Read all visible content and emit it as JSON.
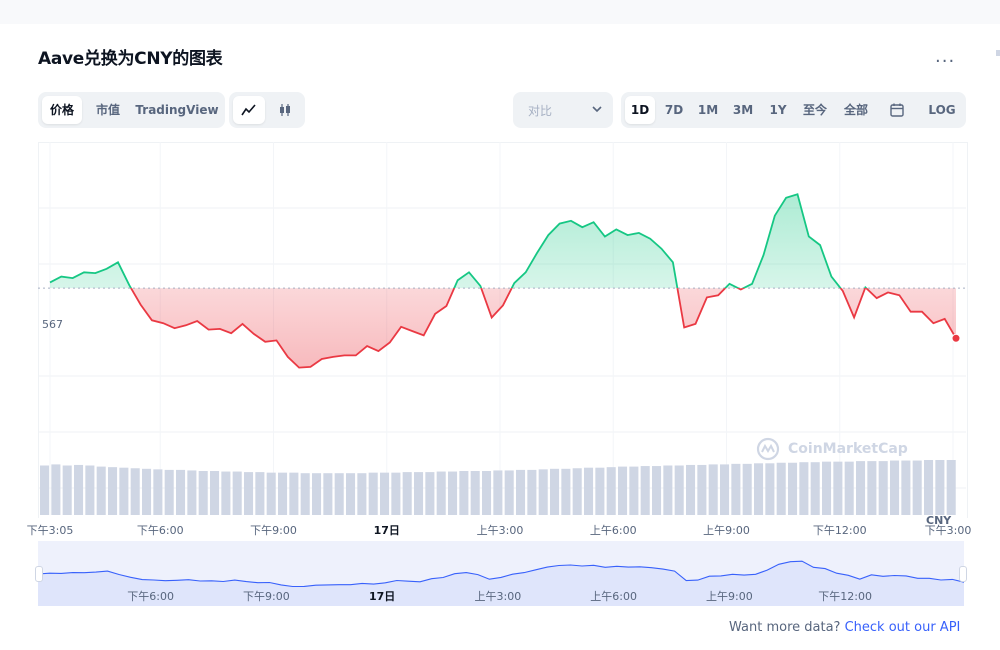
{
  "title": "Aave兑换为CNY的图表",
  "more_label": "...",
  "type_tabs": [
    "价格",
    "市值",
    "TradingView"
  ],
  "active_type": "价格",
  "chart_style_icons": [
    "line-chart-icon",
    "candlestick-icon"
  ],
  "compare": {
    "label": "对比"
  },
  "ranges": [
    "1D",
    "7D",
    "1M",
    "3M",
    "1Y",
    "至今",
    "全部",
    "LOG"
  ],
  "active_range": "1D",
  "currency": "CNY",
  "watermark": "CoinMarketCap",
  "footer": {
    "text": "Want more data?",
    "link": "Check out our API"
  },
  "colors": {
    "up": "#16c784",
    "down": "#ea3943",
    "accent": "#3861fb",
    "volume": "#cfd6e4"
  },
  "chart_data": {
    "type": "line",
    "baseline": 567,
    "ylabel_visible": "567",
    "x_ticks": [
      "下午3:05",
      "下午6:00",
      "下午9:00",
      "17日",
      "上午3:00",
      "上午6:00",
      "上午9:00",
      "下午12:00",
      "下午3:00"
    ],
    "x_tick_hours": [
      0,
      2.92,
      5.92,
      8.92,
      11.92,
      14.92,
      17.92,
      20.92,
      23.92
    ],
    "ylim": [
      543,
      586
    ],
    "x_hours": [
      0,
      0.3,
      0.6,
      0.9,
      1.2,
      1.5,
      1.8,
      2.1,
      2.4,
      2.7,
      3.0,
      3.3,
      3.6,
      3.9,
      4.2,
      4.5,
      4.8,
      5.1,
      5.4,
      5.7,
      6.0,
      6.3,
      6.6,
      6.9,
      7.2,
      7.5,
      7.8,
      8.1,
      8.4,
      8.7,
      9.0,
      9.3,
      9.6,
      9.9,
      10.2,
      10.5,
      10.8,
      11.1,
      11.4,
      11.7,
      12.0,
      12.3,
      12.6,
      12.9,
      13.2,
      13.5,
      13.8,
      14.1,
      14.4,
      14.7,
      15.0,
      15.3,
      15.6,
      15.9,
      16.2,
      16.5,
      16.8,
      17.1,
      17.4,
      17.7,
      18.0,
      18.3,
      18.6,
      18.9,
      19.2,
      19.5,
      19.8,
      20.1,
      20.4,
      20.7,
      21.0,
      21.3,
      21.6,
      21.9,
      22.2,
      22.5,
      22.8,
      23.1,
      23.4,
      23.7,
      24.0
    ],
    "values": [
      567.8,
      568.6,
      568.4,
      569.2,
      569.1,
      569.7,
      570.6,
      567.4,
      564.7,
      562.5,
      562.1,
      561.4,
      561.8,
      562.4,
      561.2,
      561.3,
      560.7,
      562.0,
      560.6,
      559.5,
      559.7,
      557.4,
      555.9,
      556.0,
      557.1,
      557.4,
      557.6,
      557.6,
      558.9,
      558.2,
      559.4,
      561.6,
      561.0,
      560.4,
      563.4,
      564.5,
      568.1,
      569.2,
      567.3,
      562.9,
      564.6,
      567.7,
      569.2,
      571.9,
      574.4,
      576.0,
      576.4,
      575.5,
      576.2,
      574.2,
      575.2,
      574.4,
      574.7,
      573.9,
      572.5,
      570.6,
      561.5,
      562.0,
      565.7,
      566.0,
      567.6,
      566.8,
      567.6,
      571.6,
      577.1,
      579.6,
      580.1,
      574.2,
      573.0,
      568.6,
      566.6,
      562.9,
      567.1,
      565.6,
      566.4,
      566.0,
      563.7,
      563.7,
      562.1,
      562.7,
      560.0
    ],
    "volume": [
      0.9,
      0.92,
      0.9,
      0.91,
      0.9,
      0.88,
      0.87,
      0.86,
      0.85,
      0.84,
      0.83,
      0.82,
      0.82,
      0.81,
      0.8,
      0.8,
      0.79,
      0.79,
      0.78,
      0.78,
      0.77,
      0.77,
      0.77,
      0.76,
      0.76,
      0.76,
      0.76,
      0.76,
      0.76,
      0.77,
      0.77,
      0.77,
      0.78,
      0.78,
      0.78,
      0.79,
      0.79,
      0.8,
      0.8,
      0.8,
      0.81,
      0.81,
      0.82,
      0.82,
      0.83,
      0.84,
      0.84,
      0.85,
      0.86,
      0.86,
      0.87,
      0.88,
      0.88,
      0.89,
      0.89,
      0.9,
      0.9,
      0.91,
      0.91,
      0.92,
      0.92,
      0.93,
      0.93,
      0.94,
      0.94,
      0.95,
      0.95,
      0.96,
      0.96,
      0.97,
      0.97,
      0.97,
      0.98,
      0.98,
      0.98,
      0.99,
      0.99,
      0.99,
      1.0,
      1.0,
      1.0
    ],
    "last_point_marker": true,
    "grid": true
  },
  "navigator": {
    "labels": [
      "下午6:00",
      "下午9:00",
      "17日",
      "上午3:00",
      "上午6:00",
      "上午9:00",
      "下午12:00"
    ],
    "label_hours": [
      2.92,
      5.92,
      8.92,
      11.92,
      14.92,
      17.92,
      20.92
    ]
  }
}
